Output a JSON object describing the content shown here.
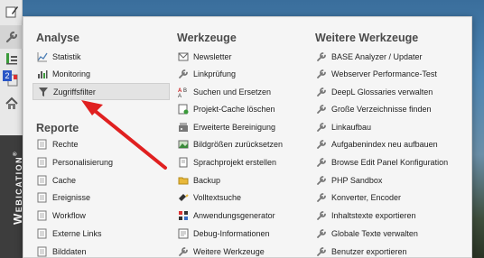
{
  "sidebar": {
    "brand": "Webication",
    "brand_mark": "®",
    "badge": "2",
    "buttons": [
      {
        "icon": "edit-icon"
      },
      {
        "icon": "wrench-icon"
      },
      {
        "icon": "chart-list-icon"
      },
      {
        "icon": "report-icon"
      },
      {
        "icon": "home-icon"
      }
    ]
  },
  "menu": {
    "columns": [
      {
        "sections": [
          {
            "title": "Analyse",
            "items": [
              {
                "label": "Statistik",
                "icon": "line-chart-icon"
              },
              {
                "label": "Monitoring",
                "icon": "bar-chart-icon"
              },
              {
                "label": "Zugriffsfilter",
                "icon": "filter-icon",
                "selected": true
              }
            ]
          },
          {
            "title": "Reporte",
            "items": [
              {
                "label": "Rechte",
                "icon": "document-icon"
              },
              {
                "label": "Personalisierung",
                "icon": "document-icon"
              },
              {
                "label": "Cache",
                "icon": "document-icon"
              },
              {
                "label": "Ereignisse",
                "icon": "document-icon"
              },
              {
                "label": "Workflow",
                "icon": "document-icon"
              },
              {
                "label": "Externe Links",
                "icon": "document-icon"
              },
              {
                "label": "Bilddaten",
                "icon": "document-icon"
              }
            ]
          }
        ]
      },
      {
        "sections": [
          {
            "title": "Werkzeuge",
            "items": [
              {
                "label": "Newsletter",
                "icon": "newsletter-icon"
              },
              {
                "label": "Linkprüfung",
                "icon": "wrench-icon"
              },
              {
                "label": "Suchen und Ersetzen",
                "icon": "search-replace-icon"
              },
              {
                "label": "Projekt-Cache löschen",
                "icon": "cache-clear-icon"
              },
              {
                "label": "Erweiterte Bereinigung",
                "icon": "cleanup-icon"
              },
              {
                "label": "Bildgrößen zurücksetzen",
                "icon": "image-icon"
              },
              {
                "label": "Sprachprojekt erstellen",
                "icon": "language-icon"
              },
              {
                "label": "Backup",
                "icon": "folder-icon"
              },
              {
                "label": "Volltextsuche",
                "icon": "flashlight-icon"
              },
              {
                "label": "Anwendungsgenerator",
                "icon": "generator-icon"
              },
              {
                "label": "Debug-Informationen",
                "icon": "debug-icon"
              },
              {
                "label": "Weitere Werkzeuge",
                "icon": "wrench-icon"
              }
            ]
          }
        ]
      },
      {
        "sections": [
          {
            "title": "Weitere Werkzeuge",
            "items": [
              {
                "label": "BASE Analyzer / Updater",
                "icon": "wrench-icon"
              },
              {
                "label": "Webserver Performance-Test",
                "icon": "wrench-icon"
              },
              {
                "label": "DeepL Glossaries verwalten",
                "icon": "wrench-icon"
              },
              {
                "label": "Große Verzeichnisse finden",
                "icon": "wrench-icon"
              },
              {
                "label": "Linkaufbau",
                "icon": "wrench-icon"
              },
              {
                "label": "Aufgabenindex neu aufbauen",
                "icon": "wrench-icon"
              },
              {
                "label": "Browse Edit Panel Konfiguration",
                "icon": "wrench-icon"
              },
              {
                "label": "PHP Sandbox",
                "icon": "wrench-icon"
              },
              {
                "label": "Konverter, Encoder",
                "icon": "wrench-icon"
              },
              {
                "label": "Inhaltstexte exportieren",
                "icon": "wrench-icon"
              },
              {
                "label": "Globale Texte verwalten",
                "icon": "wrench-icon"
              },
              {
                "label": "Benutzer exportieren",
                "icon": "wrench-icon"
              }
            ]
          }
        ]
      }
    ]
  },
  "annotation": {
    "color": "#e02020"
  }
}
